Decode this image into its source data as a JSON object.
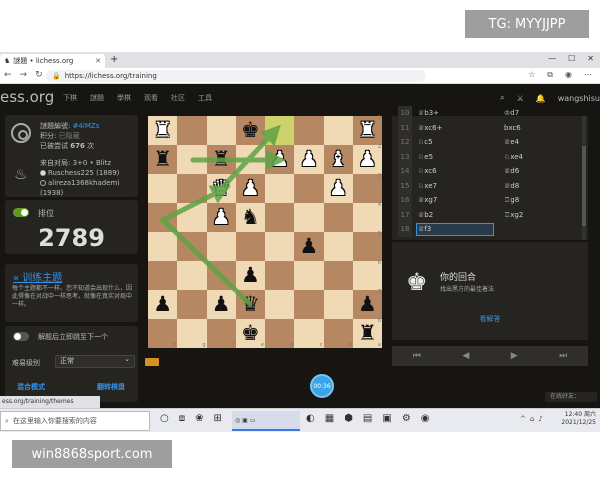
{
  "watermarks": {
    "top": "TG: MYYJJPP",
    "bottom": "win8868sport.com"
  },
  "browser": {
    "tab_title": "謎題 • lichess.org",
    "new_tab": "+",
    "url": "https://lichess.org/training",
    "status_url": "ess.org/training/themes"
  },
  "header": {
    "logo": "ess.org",
    "nav": [
      "下棋",
      "謎題",
      "學棋",
      "观看",
      "社区",
      "工具"
    ],
    "username": "wangshisu"
  },
  "puzzle_info": {
    "puzzle_label": "謎題編號:",
    "puzzle_id": "#4iMZs",
    "rating_label": "积分:",
    "rating_value": "已隐藏",
    "played_prefix": "已被尝试",
    "played_count": "676",
    "played_suffix": "次",
    "from_game_prefix": "来自对局:",
    "from_game_time": "3+0 • Blitz",
    "white_player": "Ruschess225 (1889)",
    "black_player": "alireza1368khademi (1938)"
  },
  "rating_card": {
    "label": "排位",
    "value": "2789",
    "toggle_on": true
  },
  "theme_card": {
    "title": "训练主题",
    "description": "每个主题都不一样。您不知道会出现什么，因此得像在对战中一样思考。就像在真实对局中一样。"
  },
  "settings_card": {
    "jump_label": "解题后立即跳至下一个",
    "difficulty_label": "难易级别",
    "difficulty_value": "正常",
    "button_left": "混合模式",
    "button_right": "翻转棋盘"
  },
  "board": {
    "rows": [
      [
        "wR",
        "",
        "",
        "bK",
        "",
        "",
        "",
        "wR"
      ],
      [
        "bR",
        "",
        "bR",
        "",
        "wP",
        "wP",
        "wB",
        "wP"
      ],
      [
        "",
        "",
        "wQ",
        "wP",
        "",
        "",
        "wP",
        ""
      ],
      [
        "",
        "",
        "wP",
        "bN",
        "",
        "",
        "",
        ""
      ],
      [
        "",
        "",
        "",
        "",
        "",
        "bP",
        "",
        ""
      ],
      [
        "",
        "",
        "",
        "bP",
        "",
        "",
        "",
        ""
      ],
      [
        "bP",
        "",
        "bP",
        "bQ",
        "",
        "",
        "",
        "bP"
      ],
      [
        "",
        "",
        "",
        "bK",
        "",
        "",
        "",
        "bR"
      ]
    ],
    "coords_files": [
      "h",
      "g",
      "f",
      "e",
      "d",
      "c",
      "b",
      "a"
    ],
    "coords_ranks": [
      "1",
      "2",
      "3",
      "4",
      "5",
      "6",
      "7",
      "8"
    ]
  },
  "moves": [
    {
      "num": "10",
      "w": "♕b3+",
      "b": "♔d7"
    },
    {
      "num": "11",
      "w": "♕xc6+",
      "b": "bxc6"
    },
    {
      "num": "12",
      "w": "♘c5",
      "b": "♕e4"
    },
    {
      "num": "13",
      "w": "♘e5",
      "b": "♘xe4"
    },
    {
      "num": "14",
      "w": "♘xc6",
      "b": "♕d6"
    },
    {
      "num": "15",
      "w": "♘xe7",
      "b": "♕d8"
    },
    {
      "num": "16",
      "w": "♕xg7",
      "b": "♖g8"
    },
    {
      "num": "17",
      "w": "♕b2",
      "b": "♖xg2"
    },
    {
      "num": "18",
      "w": "♕f3",
      "b": ""
    }
  ],
  "turn_panel": {
    "title": "你的回合",
    "hint": "找出黑方的最佳着法",
    "view_solution": "看解答"
  },
  "controls": [
    "⏮",
    "◀",
    "▶",
    "⏭"
  ],
  "floating_button": "00:36",
  "friends_label": "在线好友：",
  "taskbar": {
    "search_placeholder": "在这里输入你要搜索的内容",
    "time": "12:40",
    "date": "2021/12/25",
    "weather": "周六"
  },
  "colors": {
    "accent": "#3692e7",
    "board_light": "#f0d9b5",
    "board_dark": "#b58863",
    "arrow": "#5ea344"
  }
}
